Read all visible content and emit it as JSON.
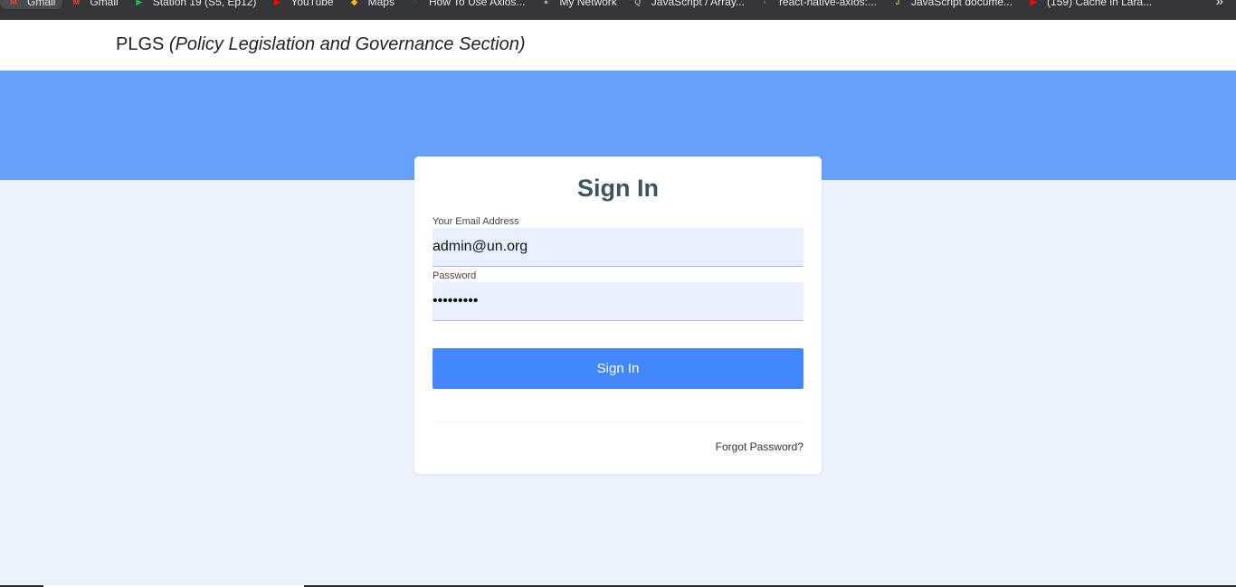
{
  "bookmarks": [
    {
      "label": "Gmail",
      "icon": "gmail-icon",
      "color": "#ea4335",
      "glyph": "M",
      "active": true
    },
    {
      "label": "Gmail",
      "icon": "gmail-icon",
      "color": "#ea4335",
      "glyph": "M"
    },
    {
      "label": "Station 19 (S5, Ep12)",
      "icon": "play-icon",
      "color": "#34a853",
      "glyph": "▶"
    },
    {
      "label": "YouTube",
      "icon": "youtube-icon",
      "color": "#ff0000",
      "glyph": "▶"
    },
    {
      "label": "Maps",
      "icon": "maps-pin-icon",
      "color": "#fbbc04",
      "glyph": "◆"
    },
    {
      "label": "How To Use Axios...",
      "icon": "axios-icon",
      "color": "#1a73e8",
      "glyph": "◌"
    },
    {
      "label": "My Network",
      "icon": "globe-icon",
      "color": "#9aa0a6",
      "glyph": "●"
    },
    {
      "label": "JavaScript / Array...",
      "icon": "search-doc-icon",
      "color": "#9aa0a6",
      "glyph": "Q"
    },
    {
      "label": "react-native-axios:...",
      "icon": "github-icon",
      "color": "#5f6368",
      "glyph": "◐"
    },
    {
      "label": "JavaScript docume...",
      "icon": "js-doc-icon",
      "color": "#c5b34a",
      "glyph": "J"
    },
    {
      "label": "(159) Cache in Lara...",
      "icon": "youtube-icon",
      "color": "#ff0000",
      "glyph": "▶"
    }
  ],
  "bookmarks_overflow": "»",
  "header": {
    "brand_short": "PLGS",
    "brand_full": "(Policy Legislation and Governance Section)"
  },
  "signin": {
    "title": "Sign In",
    "email_label": "Your Email Address",
    "email_value": "admin@un.org",
    "password_label": "Password",
    "password_value": "•••••••••",
    "submit_label": "Sign In",
    "forgot_label": "Forgot Password?"
  },
  "colors": {
    "hero": "#679ffd",
    "background": "#ebf2fe",
    "button": "#4287fd",
    "title": "#3f5462",
    "input_bg": "#e8f0fe"
  }
}
